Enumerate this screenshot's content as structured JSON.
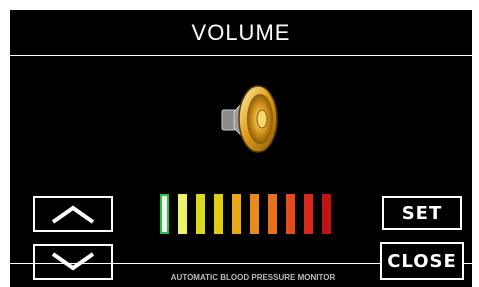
{
  "screen": {
    "title": "VOLUME",
    "footer_text": "AUTOMATIC BLOOD PRESSURE MONITOR"
  },
  "icons": {
    "speaker": "speaker-icon",
    "up": "chevron-up-icon",
    "down": "chevron-down-icon"
  },
  "buttons": {
    "set_label": "SET",
    "close_label": "CLOSE"
  },
  "volume_meter": {
    "total_levels": 10,
    "level": 10,
    "colors": [
      "#f4f4f0",
      "#ecf06a",
      "#d8d820",
      "#e0cc10",
      "#e8a818",
      "#e88a1c",
      "#e8701c",
      "#e44c1c",
      "#d82a1c",
      "#c01414"
    ]
  }
}
